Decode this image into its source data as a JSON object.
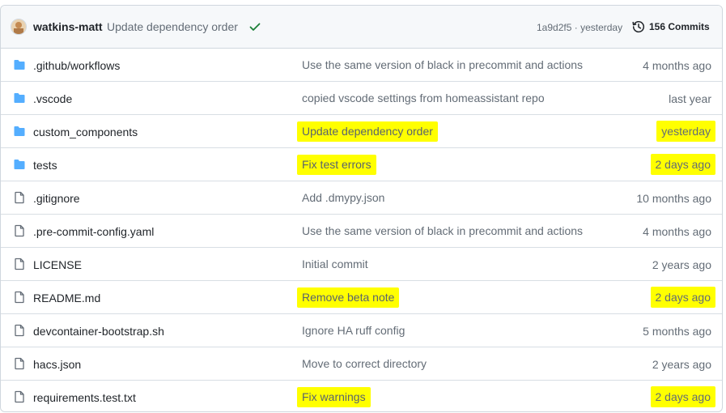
{
  "header": {
    "author": "watkins-matt",
    "commit_message": "Update dependency order",
    "sha": "1a9d2f5",
    "separator": "·",
    "time": "yesterday",
    "commits_label": "156 Commits"
  },
  "colors": {
    "folder": "#54aeff",
    "file": "#636c76",
    "check": "#1a7f37",
    "highlight": "#ffff00"
  },
  "files": [
    {
      "name": ".github/workflows",
      "type": "folder",
      "message": "Use the same version of black in precommit and actions",
      "age": "4 months ago",
      "highlighted": false
    },
    {
      "name": ".vscode",
      "type": "folder",
      "message": "copied vscode settings from homeassistant repo",
      "age": "last year",
      "highlighted": false
    },
    {
      "name": "custom_components",
      "type": "folder",
      "message": "Update dependency order",
      "age": "yesterday",
      "highlighted": true
    },
    {
      "name": "tests",
      "type": "folder",
      "message": "Fix test errors",
      "age": "2 days ago",
      "highlighted": true
    },
    {
      "name": ".gitignore",
      "type": "file",
      "message": "Add .dmypy.json",
      "age": "10 months ago",
      "highlighted": false
    },
    {
      "name": ".pre-commit-config.yaml",
      "type": "file",
      "message": "Use the same version of black in precommit and actions",
      "age": "4 months ago",
      "highlighted": false
    },
    {
      "name": "LICENSE",
      "type": "file",
      "message": "Initial commit",
      "age": "2 years ago",
      "highlighted": false
    },
    {
      "name": "README.md",
      "type": "file",
      "message": "Remove beta note",
      "age": "2 days ago",
      "highlighted": true
    },
    {
      "name": "devcontainer-bootstrap.sh",
      "type": "file",
      "message": "Ignore HA ruff config",
      "age": "5 months ago",
      "highlighted": false
    },
    {
      "name": "hacs.json",
      "type": "file",
      "message": "Move to correct directory",
      "age": "2 years ago",
      "highlighted": false
    },
    {
      "name": "requirements.test.txt",
      "type": "file",
      "message": "Fix warnings",
      "age": "2 days ago",
      "highlighted": true
    }
  ]
}
